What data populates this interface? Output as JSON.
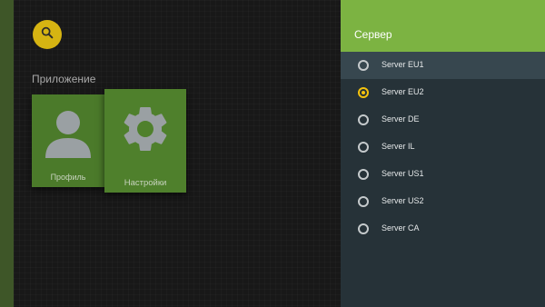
{
  "colors": {
    "accent_yellow": "#d6b412",
    "tile_green": "#4b7a2a",
    "header_green": "#7cb342",
    "panel_bg": "#263238",
    "selected_radio": "#f4c20d"
  },
  "toolbar": {
    "search_icon": "search-icon"
  },
  "main": {
    "section_title": "Приложение",
    "tiles": [
      {
        "label": "Профиль",
        "icon": "person-icon"
      },
      {
        "label": "Настройки",
        "icon": "gear-icon"
      }
    ]
  },
  "panel": {
    "title": "Сервер",
    "options": [
      {
        "label": "Server EU1",
        "checked": false,
        "focused": true
      },
      {
        "label": "Server EU2",
        "checked": true,
        "focused": false
      },
      {
        "label": "Server DE",
        "checked": false,
        "focused": false
      },
      {
        "label": "Server IL",
        "checked": false,
        "focused": false
      },
      {
        "label": "Server US1",
        "checked": false,
        "focused": false
      },
      {
        "label": "Server US2",
        "checked": false,
        "focused": false
      },
      {
        "label": "Server CA",
        "checked": false,
        "focused": false
      }
    ]
  }
}
